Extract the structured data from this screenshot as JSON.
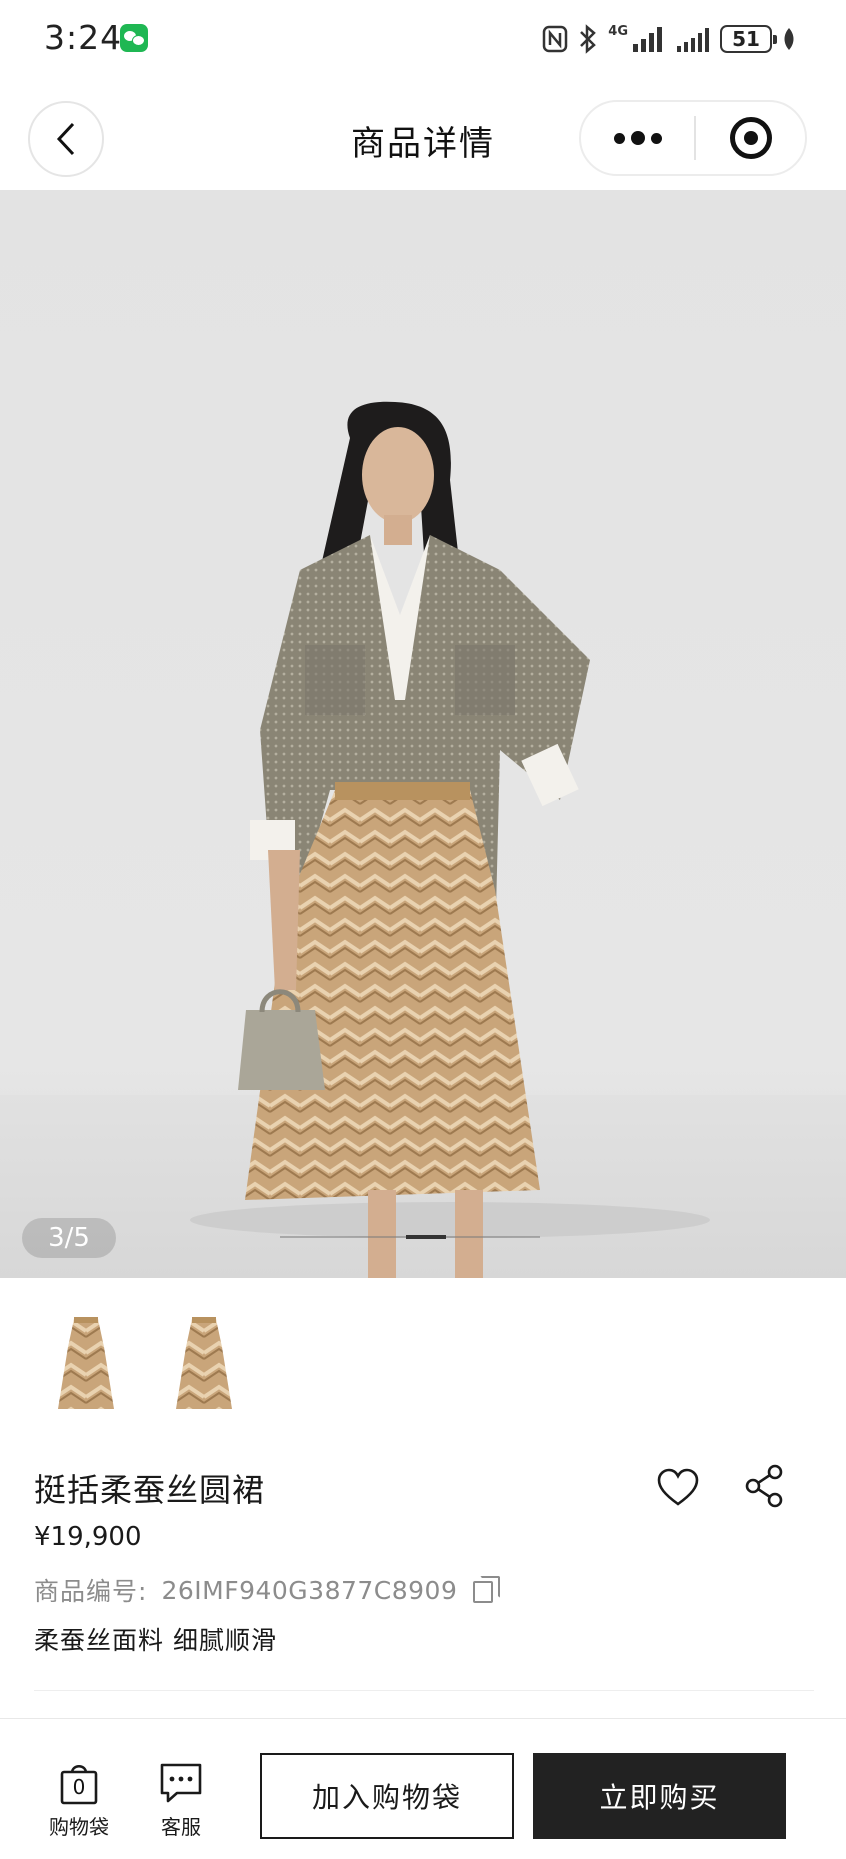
{
  "status_bar": {
    "time": "3:24",
    "network": "4G",
    "battery": "51"
  },
  "nav": {
    "title": "商品详情"
  },
  "gallery": {
    "indicator": "3/5"
  },
  "product": {
    "name": "挺括柔蚕丝圆裙",
    "price": "¥19,900",
    "sku_label": "商品编号:",
    "sku_value": "26IMF940G3877C8909",
    "description": "柔蚕丝面料 细腻顺滑"
  },
  "bottom_bar": {
    "bag_count": "0",
    "bag_label": "购物袋",
    "service_label": "客服",
    "add_to_bag": "加入购物袋",
    "buy_now": "立即购买"
  },
  "colors": {
    "buy_button": "#222222",
    "wechat_green": "#1fb753",
    "skirt_tone": "#c9a57a",
    "jacket_tone": "#8a8575"
  }
}
